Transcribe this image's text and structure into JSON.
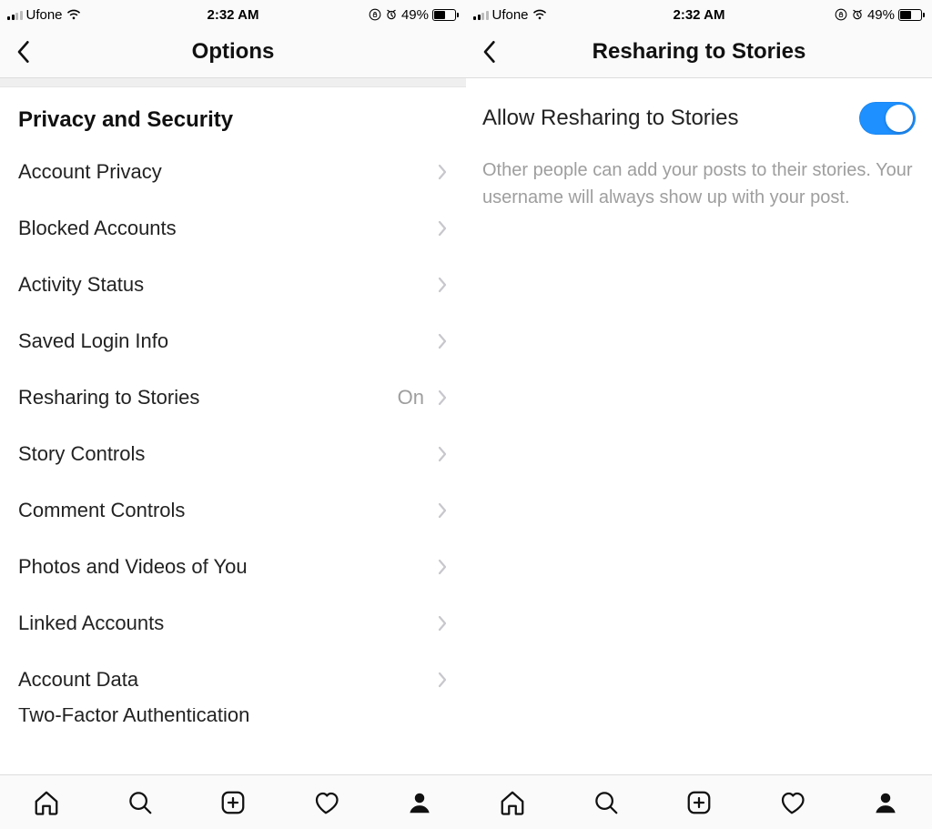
{
  "status": {
    "carrier": "Ufone",
    "time": "2:32 AM",
    "battery_pct": "49%"
  },
  "left": {
    "title": "Options",
    "section_header": "Privacy and Security",
    "rows": [
      {
        "label": "Account Privacy",
        "value": ""
      },
      {
        "label": "Blocked Accounts",
        "value": ""
      },
      {
        "label": "Activity Status",
        "value": ""
      },
      {
        "label": "Saved Login Info",
        "value": ""
      },
      {
        "label": "Resharing to Stories",
        "value": "On"
      },
      {
        "label": "Story Controls",
        "value": ""
      },
      {
        "label": "Comment Controls",
        "value": ""
      },
      {
        "label": "Photos and Videos of You",
        "value": ""
      },
      {
        "label": "Linked Accounts",
        "value": ""
      },
      {
        "label": "Account Data",
        "value": ""
      },
      {
        "label": "Two-Factor Authentication",
        "value": ""
      }
    ]
  },
  "right": {
    "title": "Resharing to Stories",
    "toggle_label": "Allow Resharing to Stories",
    "toggle_on": true,
    "description": "Other people can add your posts to their stories. Your username will always show up with your post."
  }
}
